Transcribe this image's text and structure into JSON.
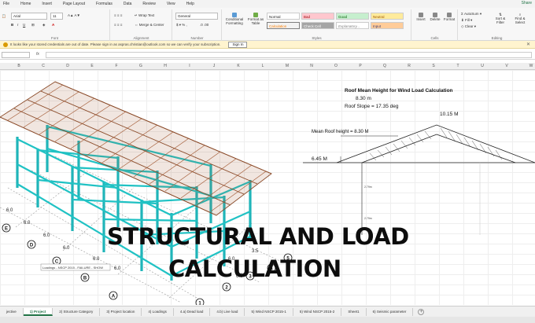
{
  "menu": {
    "tabs": [
      "File",
      "Home",
      "Insert",
      "Page Layout",
      "Formulas",
      "Data",
      "Review",
      "View",
      "Help"
    ],
    "right": "Share"
  },
  "ribbon": {
    "font_name": "Arial",
    "font_size": "11",
    "wrap_text": "Wrap Text",
    "merge_center": "Merge & Center",
    "number_format": "General",
    "conditional_formatting": "Conditional Formatting",
    "format_as_table": "Format as Table",
    "styles": {
      "normal": "Normal",
      "bad": "Bad",
      "good": "Good",
      "neutral": "Neutral",
      "calculation": "Calculation",
      "check_cell": "Check Cell",
      "explanatory": "Explanatory...",
      "input": "Input"
    },
    "insert": "Insert",
    "delete": "Delete",
    "format": "Format",
    "autosum": "AutoSum",
    "fill": "Fill",
    "clear": "Clear",
    "sort_filter": "Sort & Filter",
    "find_select": "Find & Select",
    "groups": {
      "font": "Font",
      "alignment": "Alignment",
      "number": "Number",
      "styles": "Styles",
      "cells": "Cells",
      "editing": "Editing"
    }
  },
  "message_bar": {
    "text": "It looks like your stored credentials are out of date. Please sign in as aspras.christian@outlook.com so we can verify your subscription.",
    "button": "Sign In"
  },
  "columns": [
    "B",
    "C",
    "D",
    "E",
    "F",
    "G",
    "H",
    "I",
    "J",
    "K",
    "L",
    "M",
    "N",
    "O",
    "P",
    "Q",
    "R",
    "S",
    "T",
    "U",
    "V",
    "W"
  ],
  "annotations": {
    "heading": "Roof Mean Height for Wind Load Calculation",
    "height": "8.30 m",
    "slope": "Roof Slope = 17.35 deg",
    "ridge": "10.15 M",
    "mean_roof": "Mean Roof height = 8.30 M",
    "eave": "6.45 M"
  },
  "overlay": {
    "line1": "STRUCTURAL AND LOAD",
    "line2": "CALCULATION"
  },
  "model_labels": {
    "dims": [
      "6.0",
      "6.0",
      "6.0",
      "6.0",
      "6.0",
      "6.0",
      "6.0",
      "3.5",
      "6.0"
    ],
    "axes_letters": [
      "E",
      "D",
      "C",
      "B",
      "A"
    ],
    "axes_numbers": [
      "1",
      "2",
      "3",
      "4",
      "5"
    ],
    "caption": "Loadings - NSCP 2015 - FAILURE - SHOW"
  },
  "sheet_tabs": [
    {
      "label": "jective",
      "active": false
    },
    {
      "label": "1) Project",
      "active": true
    },
    {
      "label": "2) Structure Category",
      "active": false
    },
    {
      "label": "3) Project location",
      "active": false
    },
    {
      "label": "4) Loadings",
      "active": false
    },
    {
      "label": "4.a) Dead load",
      "active": false
    },
    {
      "label": "4.b) Live load",
      "active": false
    },
    {
      "label": "5) Wind NSCP 2015-1",
      "active": false
    },
    {
      "label": "5) Wind NSCP 2015-2",
      "active": false
    },
    {
      "label": "Sheet1",
      "active": false
    },
    {
      "label": "6) Seismic parameter",
      "active": false
    }
  ]
}
